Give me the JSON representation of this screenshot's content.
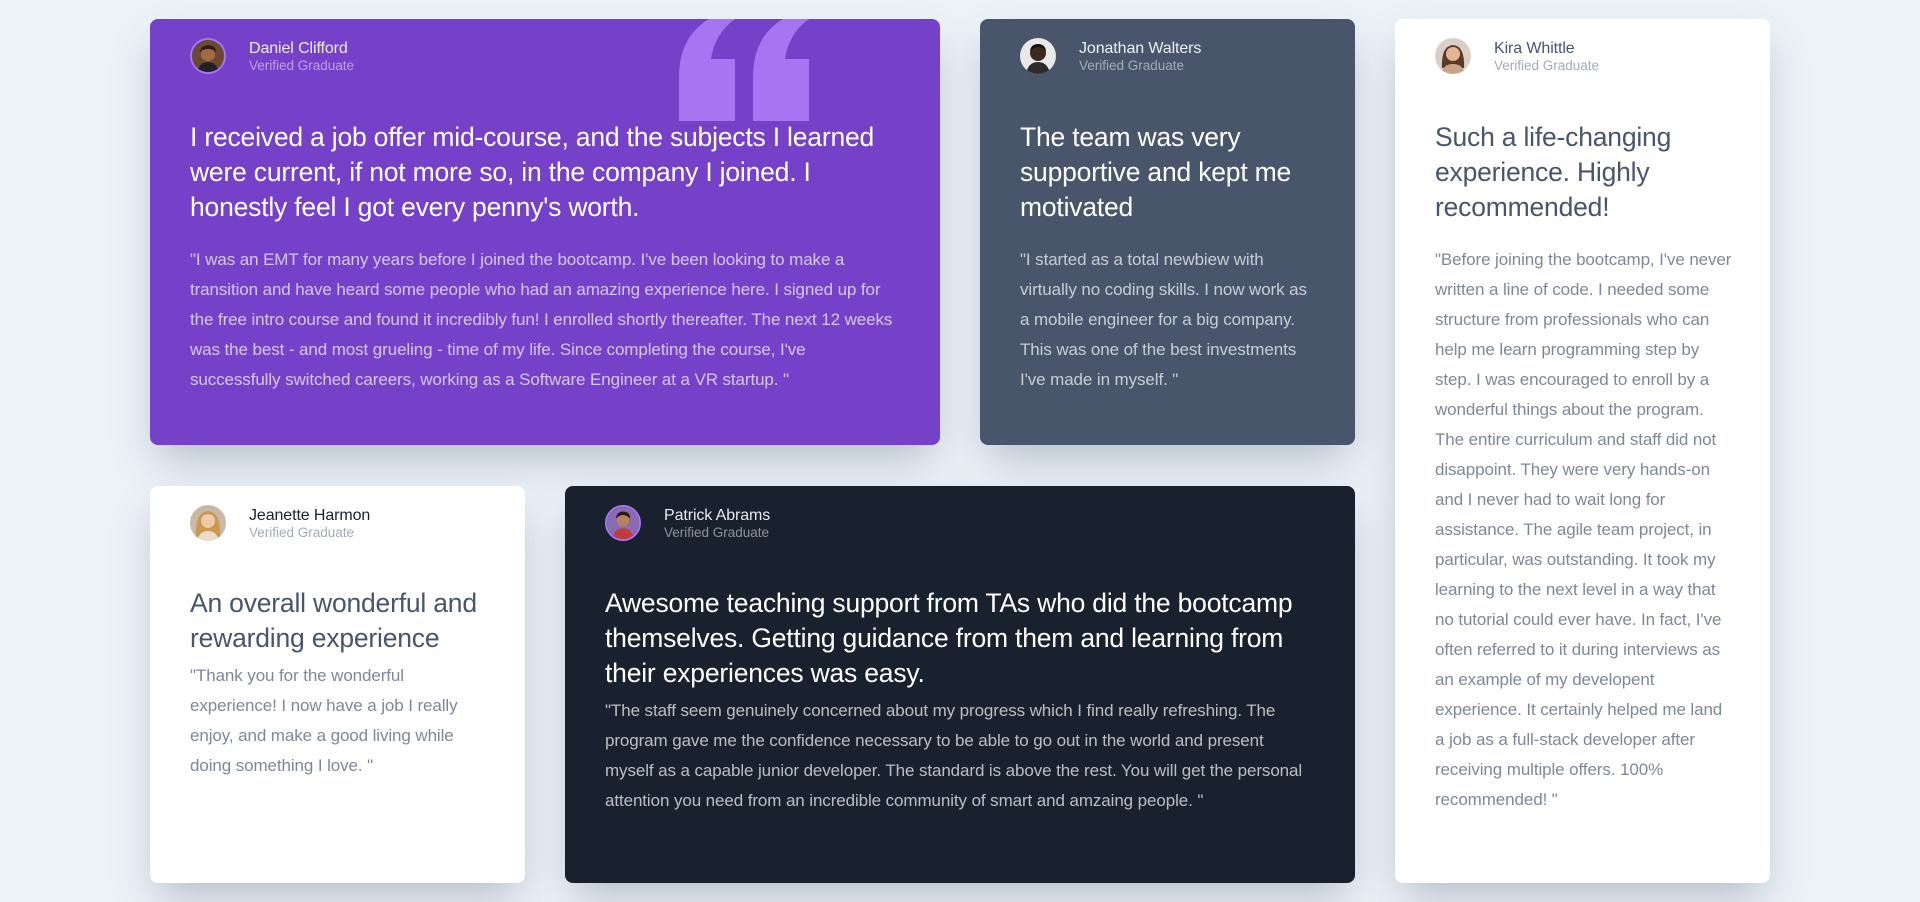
{
  "theme": {
    "background": "#ecf2f8",
    "purple": "#7541c8",
    "grey_blue": "#48556a",
    "white": "#ffffff",
    "dark": "#19212e",
    "quote_mark": "#a775f1"
  },
  "testimonials": [
    {
      "name": "Daniel Clifford",
      "role": "Verified Graduate",
      "avatar_icon": "avatar-daniel",
      "headline": "I received a job offer mid-course, and the subjects I learned were current, if not more so, in the company I joined. I honestly feel I got every penny's worth.",
      "body": "\"I was an EMT for many years before I joined the bootcamp. I've been looking to make a transition and have heard some people who had an amazing experience here. I signed up for the free intro course and found it incredibly fun! I enrolled shortly thereafter. The next 12 weeks was the best - and most grueling - time of my life. Since completing the course, I've successfully switched careers, working as a Software Engineer at a VR startup. \""
    },
    {
      "name": "Jonathan Walters",
      "role": "Verified Graduate",
      "avatar_icon": "avatar-jonathan",
      "headline": "The team was very supportive and kept me motivated",
      "body": "\"I started as a total newbiew with virtually no coding skills. I now work as a mobile engineer for a big company. This was one of the best investments I've made in myself. \""
    },
    {
      "name": "Kira Whittle",
      "role": "Verified Graduate",
      "avatar_icon": "avatar-kira",
      "headline": "Such a life-changing experience. Highly recommended!",
      "body": "\"Before joining the bootcamp, I've never written a line of code. I needed some structure from professionals who can help me learn programming step by step. I was encouraged to enroll by a wonderful things about the program. The entire curriculum and staff did not disappoint. They were very hands-on and I never had to wait long for assistance. The agile team project, in particular, was outstanding. It took my learning to the next level in a way that no tutorial could ever have. In fact, I've often referred to it during interviews as an example of my developent experience. It certainly helped me land a job as a full-stack developer after receiving multiple offers. 100% recommended! \""
    },
    {
      "name": "Jeanette Harmon",
      "role": "Verified Graduate",
      "avatar_icon": "avatar-jeanette",
      "headline": "An overall wonderful and rewarding experience",
      "body": "\"Thank you for the wonderful experience! I now have a job I really enjoy, and make a good living while doing something I love. \""
    },
    {
      "name": "Patrick Abrams",
      "role": "Verified Graduate",
      "avatar_icon": "avatar-patrick",
      "headline": "Awesome teaching support from TAs who did the bootcamp themselves. Getting guidance from them and learning from their experiences was easy.",
      "body": "\"The staff seem genuinely concerned about my progress which I find really refreshing. The program gave me the confidence necessary to be able to go out in the world and present myself as a capable junior developer. The standard is above the rest. You will get the personal attention you need from an incredible community of smart and amzaing people. \""
    }
  ]
}
